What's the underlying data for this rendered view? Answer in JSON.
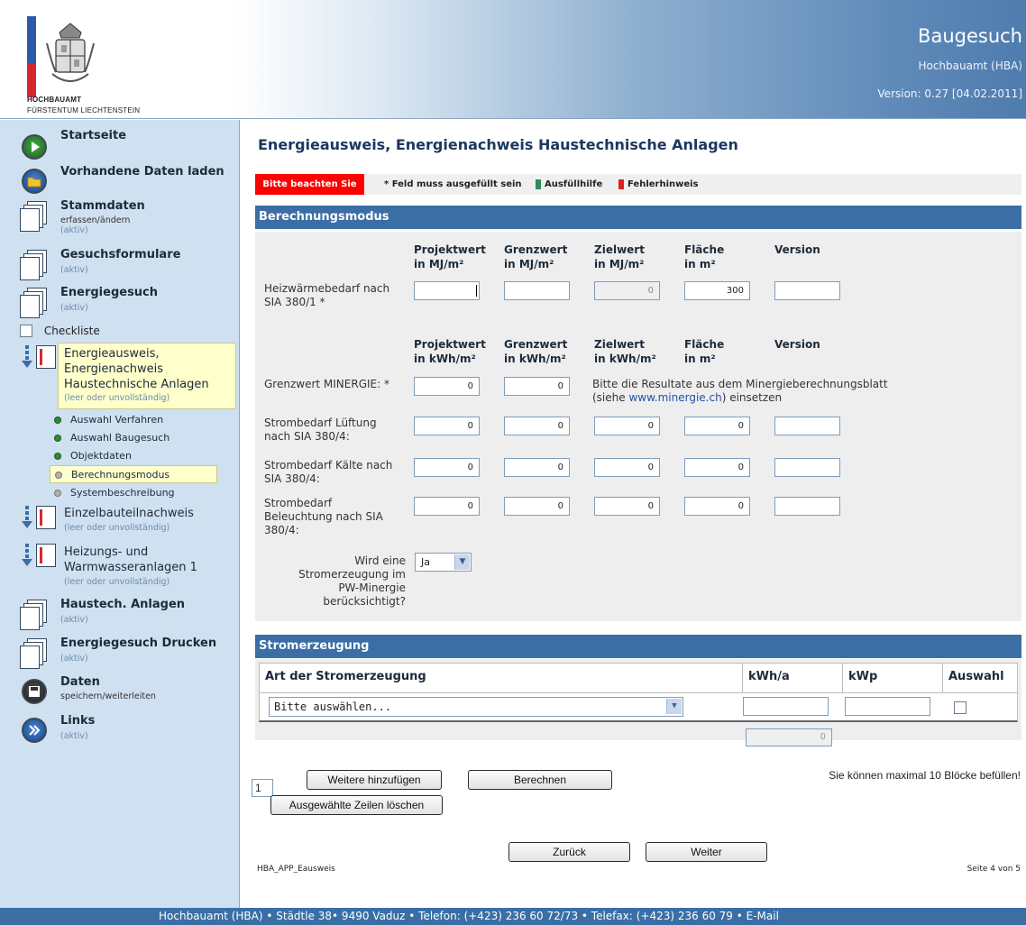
{
  "header": {
    "logo_line1": "HOCHBAUAMT",
    "logo_line2": "FÜRSTENTUM LIECHTENSTEIN",
    "app_title": "Baugesuch",
    "department": "Hochbauamt (HBA)",
    "version": "Version: 0.27 [04.02.2011]"
  },
  "sidebar": {
    "startseite": "Startseite",
    "vorhandene": "Vorhandene Daten laden",
    "stammdaten": "Stammdaten",
    "stammdaten_sub": "erfassen/ändern",
    "stammdaten_status": "(aktiv)",
    "gesuchsformulare": "Gesuchsformulare",
    "gesuchsformulare_status": "(aktiv)",
    "energiegesuch": "Energiegesuch",
    "energiegesuch_status": "(aktiv)",
    "checkliste": "Checkliste",
    "current_line1": "Energieausweis,",
    "current_line2": "Energienachweis",
    "current_line3": "Haustechnische Anlagen",
    "current_status": "(leer oder unvollständig)",
    "steps": [
      "Auswahl Verfahren",
      "Auswahl Baugesuch",
      "Objektdaten",
      "Berechnungsmodus",
      "Systembeschreibung"
    ],
    "einzel": "Einzelbauteilnachweis",
    "einzel_status": "(leer oder unvollständig)",
    "heizung_line1": "Heizungs- und",
    "heizung_line2": "Warmwasseranlagen 1",
    "heizung_status": "(leer oder unvollständig)",
    "haustech": "Haustech. Anlagen",
    "haustech_status": "(aktiv)",
    "drucken": "Energiegesuch Drucken",
    "drucken_status": "(aktiv)",
    "daten": "Daten",
    "daten_sub": "speichern/weiterleiten",
    "links": "Links",
    "links_status": "(aktiv)"
  },
  "main": {
    "page_title": "Energieausweis, Energienachweis Haustechnische Anlagen",
    "legend": {
      "warning": "Bitte beachten Sie",
      "required": "* Feld muss ausgefüllt sein",
      "help": "Ausfüllhilfe",
      "error": "Fehlerhinweis"
    },
    "section1": "Berechnungsmodus",
    "mj_headers": [
      {
        "l1": "Projektwert",
        "l2": "in MJ/m²"
      },
      {
        "l1": "Grenzwert",
        "l2": "in MJ/m²"
      },
      {
        "l1": "Zielwert",
        "l2": "in MJ/m²"
      },
      {
        "l1": "Fläche",
        "l2": "in m²"
      },
      {
        "l1": "Version",
        "l2": ""
      }
    ],
    "kwh_headers": [
      {
        "l1": "Projektwert",
        "l2": "in kWh/m²"
      },
      {
        "l1": "Grenzwert",
        "l2": "in kWh/m²"
      },
      {
        "l1": "Zielwert",
        "l2": "in kWh/m²"
      },
      {
        "l1": "Fläche",
        "l2": "in m²"
      },
      {
        "l1": "Version",
        "l2": ""
      }
    ],
    "heiz_label1": "Heizwärmebedarf nach",
    "heiz_label2": "SIA 380/1 *",
    "heiz_values": [
      "",
      "",
      "0",
      "300",
      ""
    ],
    "minergie_label": "Grenzwert MINERGIE: *",
    "minergie_values": [
      "0",
      "0"
    ],
    "minergie_note1": "Bitte die Resultate aus dem Minergieberechnungsblatt",
    "minergie_note2_pre": "(siehe ",
    "minergie_link": "www.minergie.ch",
    "minergie_note2_post": ") einsetzen",
    "lueftung_label1": "Strombedarf Lüftung",
    "lueftung_label2": "nach SIA 380/4:",
    "lueftung_values": [
      "0",
      "0",
      "0",
      "0",
      ""
    ],
    "kaelte_label1": "Strombedarf Kälte nach",
    "kaelte_label2": "SIA 380/4:",
    "kaelte_values": [
      "0",
      "0",
      "0",
      "0",
      ""
    ],
    "beleucht_label1": "Strombedarf",
    "beleucht_label2": "Beleuchtung nach SIA",
    "beleucht_label3": "380/4:",
    "beleucht_values": [
      "0",
      "0",
      "0",
      "0",
      ""
    ],
    "strom_q1": "Wird eine",
    "strom_q2": "Stromerzeugung im",
    "strom_q3": "PW-Minergie",
    "strom_q4": "berücksichtigt?",
    "strom_select": "Ja",
    "section2": "Stromerzeugung",
    "table_headers": [
      "Art der Stromerzeugung",
      "kWh/a",
      "kWp",
      "Auswahl"
    ],
    "art_select": "Bitte auswählen...",
    "sum_value": "0",
    "count_value": "1",
    "btn_add": "Weitere hinzufügen",
    "btn_calc": "Berechnen",
    "btn_delete": "Ausgewählte Zeilen löschen",
    "max_note": "Sie können maximal 10 Blöcke befüllen!",
    "btn_back": "Zurück",
    "btn_next": "Weiter",
    "form_code": "HBA_APP_Eausweis",
    "page_info": "Seite 4 von 5"
  },
  "footer": {
    "text": "Hochbauamt (HBA) • Städtle 38• 9490 Vaduz • Telefon: (+423) 236 60 72/73 • Telefax: (+423) 236 60 79 • E-Mail"
  },
  "colors": {
    "section_bar": "#3a6ea5",
    "sidebar_bg": "#cfe0f1",
    "warning_red": "#ff0000",
    "highlight_yellow": "#ffffcc"
  }
}
